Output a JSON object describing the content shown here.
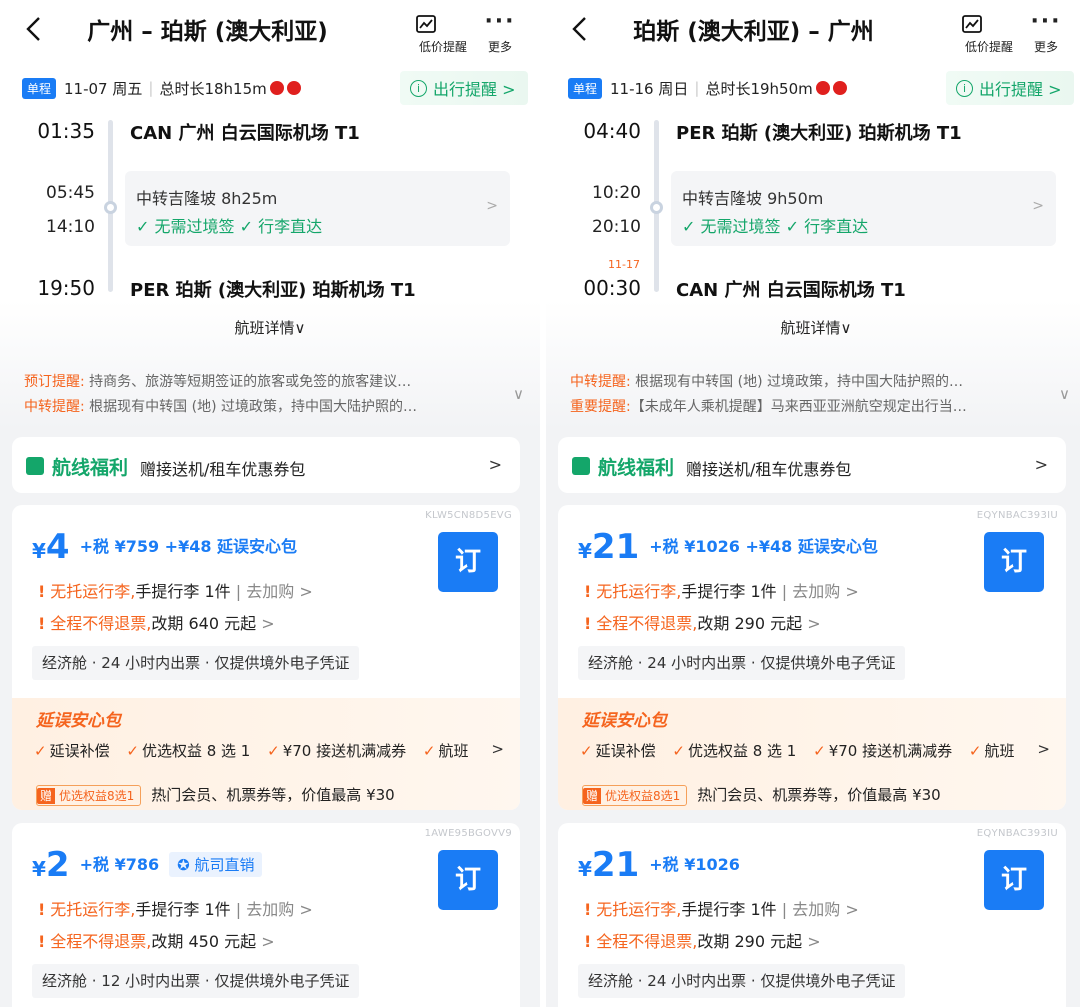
{
  "header_common": {
    "low_price_label": "低价提醒",
    "more_label": "更多"
  },
  "panels": [
    {
      "title": "广州 – 珀斯 (澳大利亚)",
      "trip_tag": "单程",
      "date": "11-07 周五",
      "duration": "总时长18h15m",
      "travel_reminder": "出行提醒 >",
      "dep_time": "01:35",
      "dep_airport": "CAN  广州 白云国际机场 T1",
      "transfer_arrive": "05:45",
      "transfer_depart": "14:10",
      "transfer_text": "中转吉隆坡 8h25m",
      "transfer_badges": "✓ 无需过境签    ✓ 行李直达",
      "arr_nextday": "",
      "arr_time": "19:50",
      "arr_airport": "PER  珀斯 (澳大利亚) 珀斯机场 T1",
      "flight_detail": "航班详情∨",
      "notice1_label": "预订提醒:",
      "notice1_text": " 持商务、旅游等短期签证的旅客或免签的旅客建议…",
      "notice2_label": "中转提醒:",
      "notice2_text": " 根据现有中转国 (地) 过境政策，持中国大陆护照的…",
      "benefit_title": "航线福利",
      "benefit_desc": "赠接送机/租车优惠券包",
      "offers": [
        {
          "code": "KLW5CN8D5EVG",
          "currency": "¥",
          "price": "4",
          "tax": "+税 ¥759 +¥48 延误安心包",
          "direct": "",
          "order": "订",
          "rule1_hl": "无托运行李,",
          "rule1_rest": "手提行李 1件",
          "rule1_link": " | 去加购 >",
          "rule2_hl": "全程不得退票,",
          "rule2_rest": "改期 640 元起",
          "rule2_link": " >",
          "cabin": "经济舱 · 24 小时内出票 · 仅提供境外电子凭证",
          "delay_title": "延误安心包",
          "delay_items": [
            "延误补偿",
            "优选权益 8 选 1",
            "¥70 接送机满减券",
            "航班"
          ],
          "gift_tag_a": "赠",
          "gift_tag_b": "优选权益8选1",
          "gift_text": "热门会员、机票券等，价值最高 ¥30"
        },
        {
          "code": "1AWE95BGOVV9",
          "currency": "¥",
          "price": "2",
          "tax": "+税 ¥786",
          "direct": "航司直销",
          "order": "订",
          "rule1_hl": "无托运行李,",
          "rule1_rest": "手提行李 1件",
          "rule1_link": " | 去加购 >",
          "rule2_hl": "全程不得退票,",
          "rule2_rest": "改期 450 元起",
          "rule2_link": " >",
          "cabin": "经济舱 · 12 小时内出票 · 仅提供境外电子凭证"
        }
      ]
    },
    {
      "title": "珀斯 (澳大利亚) – 广州",
      "trip_tag": "单程",
      "date": "11-16 周日",
      "duration": "总时长19h50m",
      "travel_reminder": "出行提醒 >",
      "dep_time": "04:40",
      "dep_airport": "PER  珀斯 (澳大利亚) 珀斯机场 T1",
      "transfer_arrive": "10:20",
      "transfer_depart": "20:10",
      "transfer_text": "中转吉隆坡 9h50m",
      "transfer_badges": "✓ 无需过境签    ✓ 行李直达",
      "arr_nextday": "11-17",
      "arr_time": "00:30",
      "arr_airport": "CAN  广州 白云国际机场 T1",
      "flight_detail": "航班详情∨",
      "notice1_label": "中转提醒:",
      "notice1_text": " 根据现有中转国 (地) 过境政策，持中国大陆护照的…",
      "notice2_label": "重要提醒:",
      "notice2_text": "【未成年人乘机提醒】马来西亚亚洲航空规定出行当…",
      "benefit_title": "航线福利",
      "benefit_desc": "赠接送机/租车优惠券包",
      "offers": [
        {
          "code": "EQYNBAC393IU",
          "currency": "¥",
          "price": "21",
          "tax": "+税 ¥1026 +¥48 延误安心包",
          "direct": "",
          "order": "订",
          "rule1_hl": "无托运行李,",
          "rule1_rest": "手提行李 1件",
          "rule1_link": " | 去加购 >",
          "rule2_hl": "全程不得退票,",
          "rule2_rest": "改期 290 元起",
          "rule2_link": " >",
          "cabin": "经济舱 · 24 小时内出票 · 仅提供境外电子凭证",
          "delay_title": "延误安心包",
          "delay_items": [
            "延误补偿",
            "优选权益 8 选 1",
            "¥70 接送机满减券",
            "航班"
          ],
          "gift_tag_a": "赠",
          "gift_tag_b": "优选权益8选1",
          "gift_text": "热门会员、机票券等，价值最高 ¥30"
        },
        {
          "code": "EQYNBAC393IU",
          "currency": "¥",
          "price": "21",
          "tax": "+税 ¥1026",
          "direct": "",
          "order": "订",
          "rule1_hl": "无托运行李,",
          "rule1_rest": "手提行李 1件",
          "rule1_link": " | 去加购 >",
          "rule2_hl": "全程不得退票,",
          "rule2_rest": "改期 290 元起",
          "rule2_link": " >",
          "cabin": "经济舱 · 24 小时内出票 · 仅提供境外电子凭证"
        }
      ]
    }
  ],
  "colors": {
    "brand_blue": "#1a7cf5",
    "green": "#14a66a",
    "orange": "#f5641e"
  }
}
